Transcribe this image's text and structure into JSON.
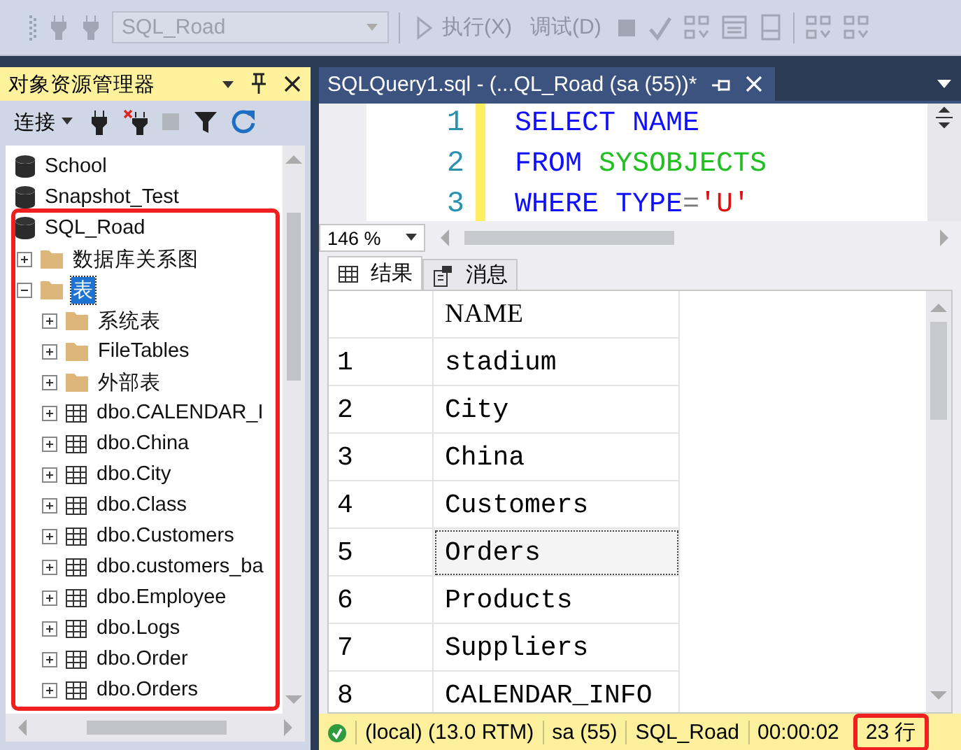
{
  "toolbar": {
    "database": "SQL_Road",
    "execute": "执行(X)",
    "debug": "调试(D)"
  },
  "object_explorer": {
    "title": "对象资源管理器",
    "connect": "连接",
    "tree_highlighted": true,
    "tree": [
      {
        "label": "School",
        "kind": "database"
      },
      {
        "label": "Snapshot_Test",
        "kind": "database"
      },
      {
        "label": "SQL_Road",
        "kind": "database",
        "selected": false,
        "children": [
          {
            "label": "数据库关系图",
            "kind": "folder",
            "expanded": false,
            "selected": false
          },
          {
            "label": "表",
            "kind": "folder",
            "expanded": true,
            "selected": true,
            "children": [
              {
                "label": "系统表",
                "kind": "folder",
                "expanded": false,
                "selected": false
              },
              {
                "label": "FileTables",
                "kind": "folder",
                "expanded": false,
                "selected": false
              },
              {
                "label": "外部表",
                "kind": "folder",
                "expanded": false,
                "selected": false
              },
              {
                "label": "dbo.CALENDAR_I",
                "kind": "table",
                "expanded": false,
                "selected": false
              },
              {
                "label": "dbo.China",
                "kind": "table",
                "expanded": false,
                "selected": false
              },
              {
                "label": "dbo.City",
                "kind": "table",
                "expanded": false,
                "selected": false
              },
              {
                "label": "dbo.Class",
                "kind": "table",
                "expanded": false,
                "selected": false
              },
              {
                "label": "dbo.Customers",
                "kind": "table",
                "expanded": false,
                "selected": false
              },
              {
                "label": "dbo.customers_ba",
                "kind": "table",
                "expanded": false,
                "selected": false
              },
              {
                "label": "dbo.Employee",
                "kind": "table",
                "expanded": false,
                "selected": false
              },
              {
                "label": "dbo.Logs",
                "kind": "table",
                "expanded": false,
                "selected": false
              },
              {
                "label": "dbo.Order",
                "kind": "table",
                "expanded": false,
                "selected": false
              },
              {
                "label": "dbo.Orders",
                "kind": "table",
                "expanded": false,
                "selected": false
              }
            ]
          }
        ]
      }
    ]
  },
  "editor": {
    "tab_title": "SQLQuery1.sql - (...QL_Road (sa (55))*",
    "lines": [
      {
        "number": "1",
        "tokens": [
          {
            "text": "SELECT NAME",
            "kind": "keyword"
          }
        ]
      },
      {
        "number": "2",
        "tokens": [
          {
            "text": "FROM ",
            "kind": "keyword"
          },
          {
            "text": "SYSOBJECTS",
            "kind": "object"
          }
        ]
      },
      {
        "number": "3",
        "tokens": [
          {
            "text": "WHERE TYPE",
            "kind": "keyword"
          },
          {
            "text": "=",
            "kind": "operator"
          },
          {
            "text": "'U'",
            "kind": "string"
          }
        ]
      }
    ],
    "zoom": "146 %"
  },
  "result_tabs": [
    {
      "label": "结果",
      "kind": "grid",
      "selected": true
    },
    {
      "label": "消息",
      "kind": "messages",
      "selected": false
    }
  ],
  "results": {
    "columns": [
      "NAME"
    ],
    "rows": [
      {
        "number": "1",
        "name": "stadium",
        "selected": false
      },
      {
        "number": "2",
        "name": "City",
        "selected": false
      },
      {
        "number": "3",
        "name": "China",
        "selected": false
      },
      {
        "number": "4",
        "name": "Customers",
        "selected": false
      },
      {
        "number": "5",
        "name": "Orders",
        "selected": true
      },
      {
        "number": "6",
        "name": "Products",
        "selected": false
      },
      {
        "number": "7",
        "name": "Suppliers",
        "selected": false
      },
      {
        "number": "8",
        "name": "CALENDAR_INFO",
        "selected": false
      }
    ]
  },
  "status_bar": [
    {
      "text": "(local) (13.0 RTM)",
      "kind": "server",
      "highlighted": false
    },
    {
      "text": "sa (55)",
      "kind": "user",
      "highlighted": false
    },
    {
      "text": "SQL_Road",
      "kind": "database",
      "highlighted": false
    },
    {
      "text": "00:00:02",
      "kind": "time",
      "highlighted": false
    },
    {
      "text": "23 行",
      "kind": "rows",
      "highlighted": true
    }
  ]
}
